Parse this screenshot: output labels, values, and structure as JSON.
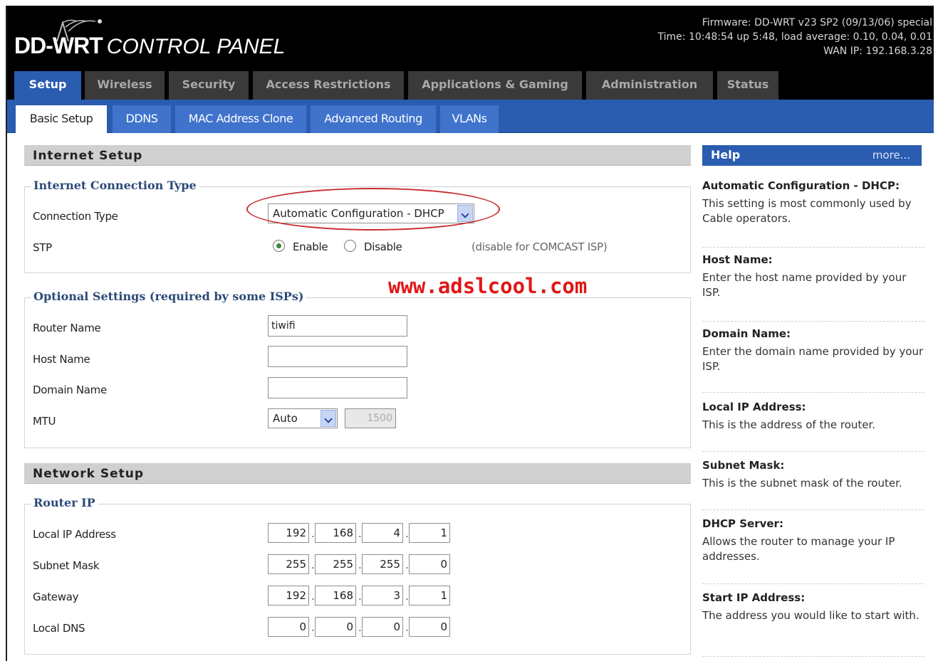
{
  "header": {
    "logo": "DD-WRT",
    "logo_sub": "CONTROL PANEL",
    "firmware": "Firmware: DD-WRT v23 SP2 (09/13/06) special",
    "time": "Time: 10:48:54 up 5:48, load average: 0.10, 0.04, 0.01",
    "wan_ip": "WAN IP: 192.168.3.28"
  },
  "main_tabs": [
    "Setup",
    "Wireless",
    "Security",
    "Access Restrictions",
    "Applications & Gaming",
    "Administration",
    "Status"
  ],
  "sub_tabs": [
    "Basic Setup",
    "DDNS",
    "MAC Address Clone",
    "Advanced Routing",
    "VLANs"
  ],
  "internet_setup": {
    "title": "Internet Setup",
    "connection_group": "Internet Connection Type",
    "connection_type_label": "Connection Type",
    "connection_type_value": "Automatic Configuration - DHCP",
    "stp_label": "STP",
    "stp_enable": "Enable",
    "stp_disable": "Disable",
    "stp_note": "(disable for COMCAST ISP)",
    "optional_group": "Optional Settings (required by some ISPs)",
    "router_name_label": "Router Name",
    "router_name_value": "tiwifi",
    "host_name_label": "Host Name",
    "host_name_value": "",
    "domain_name_label": "Domain Name",
    "domain_name_value": "",
    "mtu_label": "MTU",
    "mtu_mode": "Auto",
    "mtu_value": "1500"
  },
  "watermark": "www.adslcool.com",
  "network_setup": {
    "title": "Network Setup",
    "router_ip_group": "Router IP",
    "local_ip_label": "Local IP Address",
    "local_ip": [
      "192",
      "168",
      "4",
      "1"
    ],
    "subnet_label": "Subnet Mask",
    "subnet": [
      "255",
      "255",
      "255",
      "0"
    ],
    "gateway_label": "Gateway",
    "gateway": [
      "192",
      "168",
      "3",
      "1"
    ],
    "dns_label": "Local DNS",
    "dns": [
      "0",
      "0",
      "0",
      "0"
    ]
  },
  "help": {
    "title": "Help",
    "more": "more...",
    "sections": [
      {
        "title": "Automatic Configuration - DHCP:",
        "text": "This setting is most commonly used by Cable operators."
      },
      {
        "title": "Host Name:",
        "text": "Enter the host name provided by your ISP."
      },
      {
        "title": "Domain Name:",
        "text": "Enter the domain name provided by your ISP."
      },
      {
        "title": "Local IP Address:",
        "text": "This is the address of the router."
      },
      {
        "title": "Subnet Mask:",
        "text": "This is the subnet mask of the router."
      },
      {
        "title": "DHCP Server:",
        "text": "Allows the router to manage your IP addresses."
      },
      {
        "title": "Start IP Address:",
        "text": "The address you would like to start with."
      }
    ]
  }
}
